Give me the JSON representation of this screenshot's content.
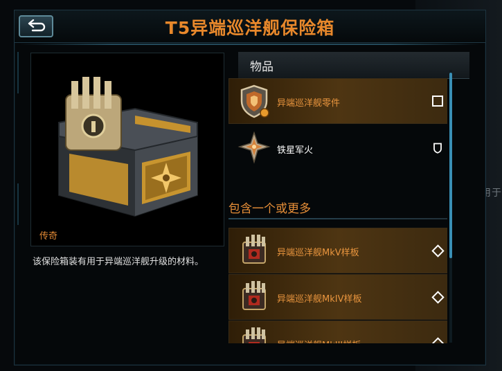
{
  "window": {
    "title": "T5异端巡洋舰保险箱",
    "back_icon": "back-arrow-icon"
  },
  "item_preview": {
    "rarity": "传奇",
    "description": "该保险箱装有用于异端巡洋舰升级的材料。"
  },
  "list": {
    "header": "物品",
    "items": [
      {
        "name": "异端巡洋舰零件",
        "icon": "shield-badge-icon",
        "mark": "square-icon",
        "highlighted": true
      },
      {
        "name": "铁星军火",
        "icon": "iron-star-icon",
        "mark": "shield-outline-icon",
        "highlighted": false
      }
    ],
    "section_label": "包含一个或更多",
    "blueprints": [
      {
        "name": "异端巡洋舰MkV样板",
        "icon": "ship-blueprint-icon",
        "mark": "diamond-icon"
      },
      {
        "name": "异端巡洋舰MkIV样板",
        "icon": "ship-blueprint-icon",
        "mark": "diamond-icon"
      },
      {
        "name": "异端巡洋舰MkIII样板",
        "icon": "ship-blueprint-icon",
        "mark": "diamond-icon"
      }
    ]
  },
  "background": {
    "ghost_text": "用于"
  },
  "colors": {
    "accent_orange": "#e8882b",
    "panel_border": "#1d3440",
    "scrollbar": "#3a8fb5"
  }
}
